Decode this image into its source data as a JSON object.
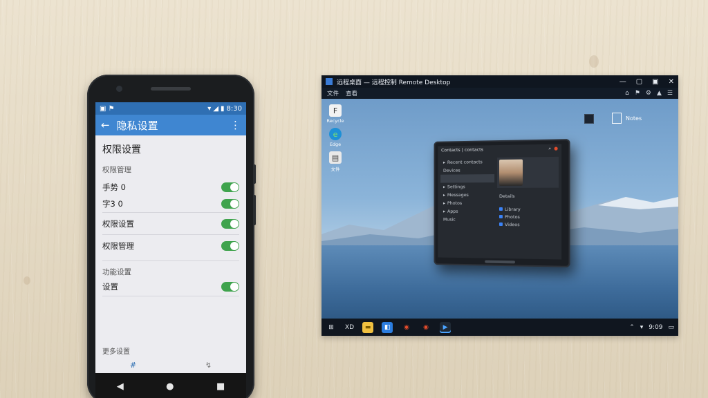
{
  "phone": {
    "status_time": "8:30",
    "status_icons": [
      "wifi-icon",
      "signal-icon",
      "battery-icon"
    ],
    "appbar_title": "隐私设置",
    "page_title": "权限设置",
    "section_label": "权限管理",
    "rows": [
      {
        "label": "手势 0",
        "toggle_on": true
      },
      {
        "label": "字3 0",
        "toggle_on": true
      },
      {
        "label": "权限设置",
        "toggle_on": true
      },
      {
        "label": "权限管理",
        "toggle_on": true
      }
    ],
    "subsection_label": "功能设置",
    "last_row": {
      "label": "设置",
      "toggle_on": true
    },
    "bottom_label": "更多设置",
    "bottom_tabs": [
      "#",
      "↯"
    ],
    "nav": [
      "◀",
      "●",
      "■"
    ]
  },
  "desktop": {
    "window_title": "远程桌面  —  远程控制 Remote Desktop",
    "window_controls": [
      "—",
      "▢",
      "▣",
      "✕"
    ],
    "menu_items": [
      "文件",
      "查看"
    ],
    "menu_right_icons": [
      "⌂",
      "⚑",
      "⚙",
      "▲",
      "☰"
    ],
    "desktop_icons": [
      {
        "label": "Recycle",
        "glyph": "F"
      },
      {
        "label": "Edge",
        "glyph": "e"
      },
      {
        "label": "文件",
        "glyph": "▤"
      }
    ],
    "top_right_label": "Notes",
    "tablet": {
      "header": "Contacts | contacts",
      "left_items": [
        "Recent contacts",
        "Devices",
        "",
        "Settings",
        "Messages",
        "Photos",
        "Apps",
        "Music"
      ],
      "right_items": [
        "Details",
        "Library",
        "Photos",
        "Videos"
      ]
    },
    "taskbar_search": "XD",
    "tray_time": "9:09"
  },
  "colors": {
    "phone_appbar": "#3f86d1",
    "toggle_on": "#3fa34d",
    "taskbar": "#10161f"
  }
}
